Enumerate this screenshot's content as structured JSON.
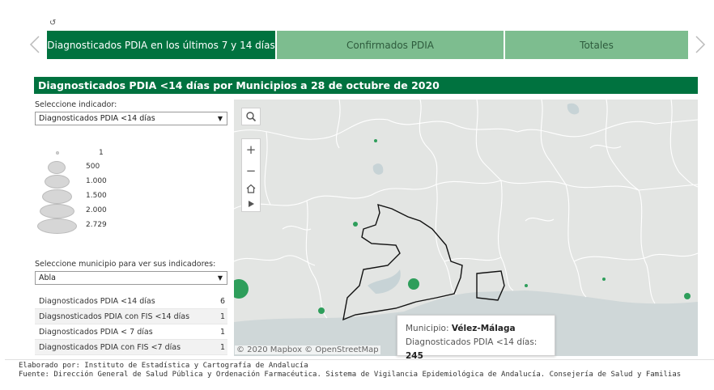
{
  "reset_glyph": "↺",
  "tabs": [
    {
      "label": "Diagnosticados PDIA en los últimos 7 y 14 días",
      "active": true
    },
    {
      "label": "Confirmados PDIA",
      "active": false
    },
    {
      "label": "Totales",
      "active": false
    }
  ],
  "section_title": "Diagnosticados PDIA <14 días por Municipios a 28 de octubre de 2020",
  "indicator_selector": {
    "label": "Seleccione indicador:",
    "value": "Diagnosticados PDIA <14 días"
  },
  "size_legend": [
    "1",
    "500",
    "1.000",
    "1.500",
    "2.000",
    "2.729"
  ],
  "municipio_selector": {
    "label": "Seleccione municipio para ver sus indicadores:",
    "value": "Abla"
  },
  "indicators": [
    {
      "label": "Diagnosticados PDIA <14 días",
      "value": "6"
    },
    {
      "label": "Diagsnosticados PDIA con FIS <14 días",
      "value": "1"
    },
    {
      "label": "Diagnosticados PDIA < 7 días",
      "value": "1"
    },
    {
      "label": "Diagnosticados PDIA con FIS <7 días",
      "value": "1"
    }
  ],
  "map": {
    "attribution": "© 2020 Mapbox  © OpenStreetMap",
    "controls": [
      "search-icon",
      "zoom-in-icon",
      "zoom-out-icon",
      "home-icon",
      "play-icon"
    ],
    "bubble_color": "#2e9e5b",
    "sea_color": "#cfd7d8"
  },
  "tooltip": {
    "municipio_label": "Municipio:",
    "municipio_value": "Vélez-Málaga",
    "metric_label": "Diagnosticados PDIA <14 días:",
    "metric_value": "245"
  },
  "footer": {
    "line1": "Elaborado por: Instituto de Estadística y Cartografía de Andalucía",
    "line2": "Fuente: Dirección General de Salud Pública y Ordenación Farmacéutica. Sistema de Vigilancia Epidemiológica de Andalucía. Consejería de Salud y Familias"
  },
  "colors": {
    "accent": "#00723f",
    "tab_inactive": "#7dbd8f"
  }
}
